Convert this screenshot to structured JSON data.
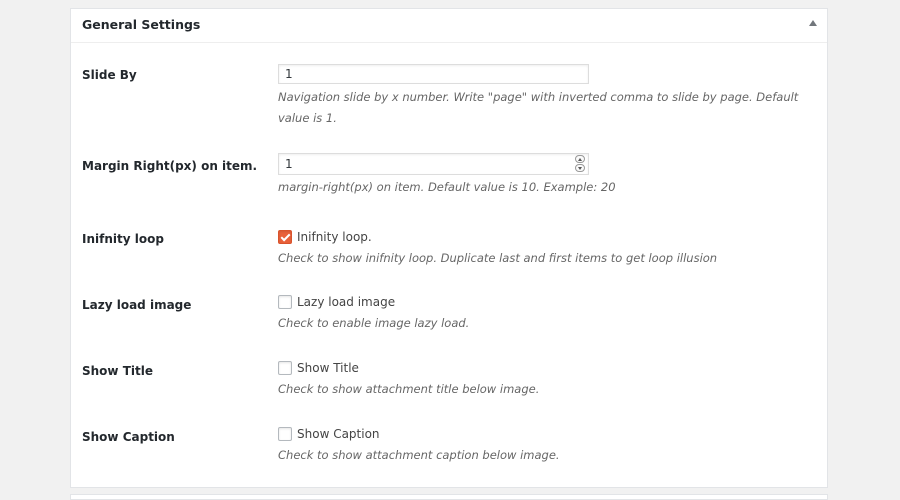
{
  "panel": {
    "title": "General Settings"
  },
  "fields": {
    "slide_by": {
      "label": "Slide By",
      "value": "1",
      "description": "Navigation slide by x number. Write \"page\" with inverted comma to slide by page. Default value is 1."
    },
    "margin_right": {
      "label": "Margin Right(px) on item.",
      "value": "1",
      "description": "margin-right(px) on item. Default value is 10. Example: 20"
    },
    "infinity_loop": {
      "label": "Inifnity loop",
      "checkbox_label": "Inifnity loop.",
      "checked": true,
      "description": "Check to show inifnity loop. Duplicate last and first items to get loop illusion"
    },
    "lazy_load": {
      "label": "Lazy load image",
      "checkbox_label": "Lazy load image",
      "checked": false,
      "description": "Check to enable image lazy load."
    },
    "show_title": {
      "label": "Show Title",
      "checkbox_label": "Show Title",
      "checked": false,
      "description": "Check to show attachment title below image."
    },
    "show_caption": {
      "label": "Show Caption",
      "checkbox_label": "Show Caption",
      "checked": false,
      "description": "Check to show attachment caption below image."
    }
  },
  "colors": {
    "checkbox_checked": "#e9613a",
    "background": "#f1f1f1",
    "panel": "#ffffff"
  },
  "icons": {
    "toggle": "triangle-up-icon"
  }
}
